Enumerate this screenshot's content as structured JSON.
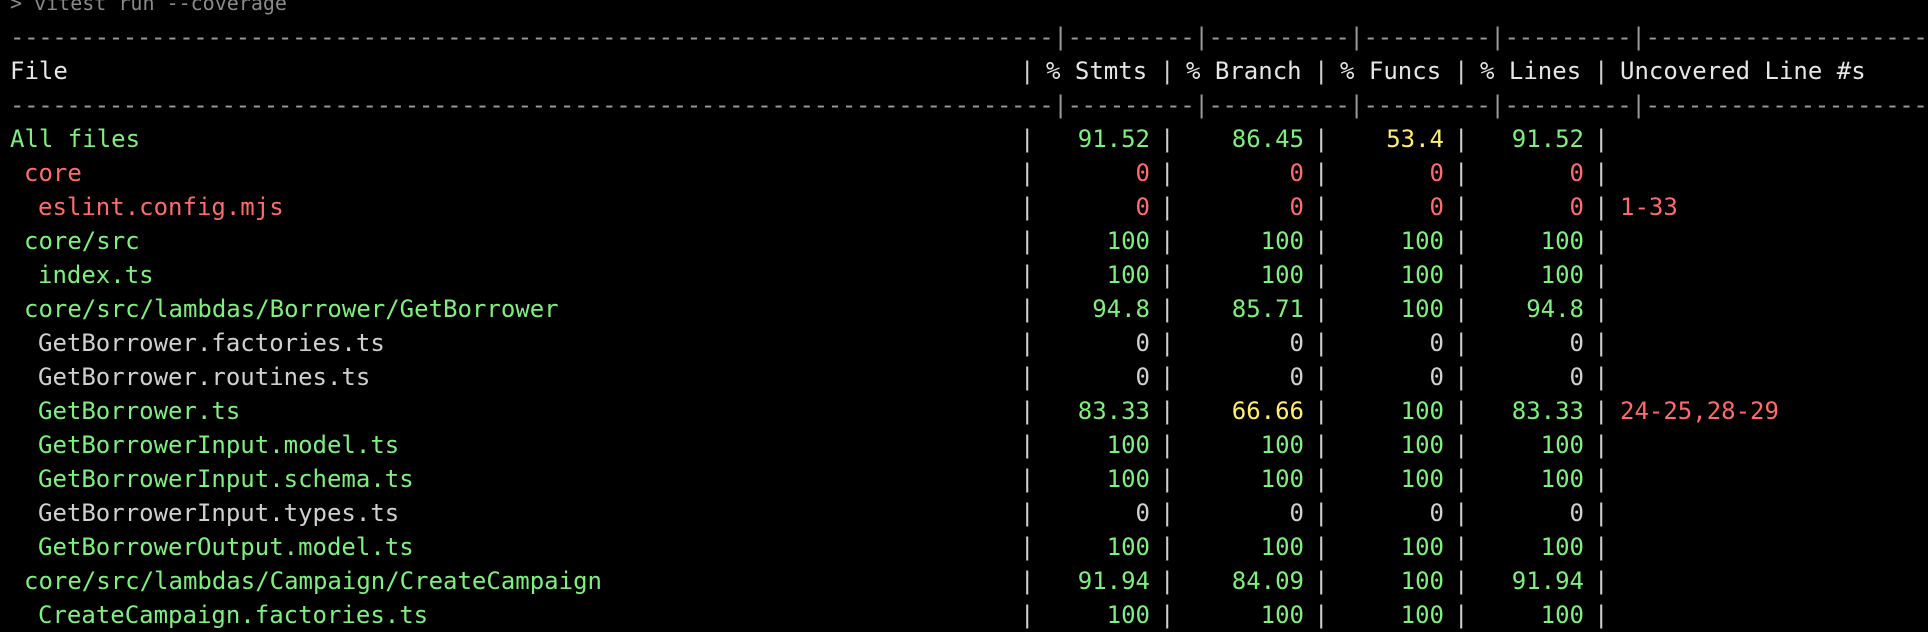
{
  "colors": {
    "green": "#7ef07e",
    "red": "#ff6b6b",
    "yellow": "#ffef6b",
    "plain": "#d0d0d0",
    "background": "#000000"
  },
  "command_line": "> vitest run --coverage",
  "separator": "--------------------------------------------------------------------------|---------|----------|---------|---------|----------------------",
  "headers": {
    "file": "File",
    "stmts": "% Stmts",
    "branch": "% Branch",
    "funcs": "% Funcs",
    "lines": "% Lines",
    "uncovered": "Uncovered Line #s"
  },
  "rows": [
    {
      "file": "All files",
      "indent": 0,
      "color": "green",
      "stmts": "91.52",
      "stmts_color": "green",
      "branch": "86.45",
      "branch_color": "green",
      "funcs": "53.4",
      "funcs_color": "yellow",
      "lines": "91.52",
      "lines_color": "green",
      "uncovered": ""
    },
    {
      "file": "core",
      "indent": 1,
      "color": "red",
      "stmts": "0",
      "stmts_color": "red",
      "branch": "0",
      "branch_color": "red",
      "funcs": "0",
      "funcs_color": "red",
      "lines": "0",
      "lines_color": "red",
      "uncovered": ""
    },
    {
      "file": "eslint.config.mjs",
      "indent": 2,
      "color": "red",
      "stmts": "0",
      "stmts_color": "red",
      "branch": "0",
      "branch_color": "red",
      "funcs": "0",
      "funcs_color": "red",
      "lines": "0",
      "lines_color": "red",
      "uncovered": "1-33"
    },
    {
      "file": "core/src",
      "indent": 1,
      "color": "green",
      "stmts": "100",
      "stmts_color": "green",
      "branch": "100",
      "branch_color": "green",
      "funcs": "100",
      "funcs_color": "green",
      "lines": "100",
      "lines_color": "green",
      "uncovered": ""
    },
    {
      "file": "index.ts",
      "indent": 2,
      "color": "green",
      "stmts": "100",
      "stmts_color": "green",
      "branch": "100",
      "branch_color": "green",
      "funcs": "100",
      "funcs_color": "green",
      "lines": "100",
      "lines_color": "green",
      "uncovered": ""
    },
    {
      "file": "core/src/lambdas/Borrower/GetBorrower",
      "indent": 1,
      "color": "green",
      "stmts": "94.8",
      "stmts_color": "green",
      "branch": "85.71",
      "branch_color": "green",
      "funcs": "100",
      "funcs_color": "green",
      "lines": "94.8",
      "lines_color": "green",
      "uncovered": ""
    },
    {
      "file": "GetBorrower.factories.ts",
      "indent": 2,
      "color": "plain",
      "stmts": "0",
      "stmts_color": "plain",
      "branch": "0",
      "branch_color": "plain",
      "funcs": "0",
      "funcs_color": "plain",
      "lines": "0",
      "lines_color": "plain",
      "uncovered": ""
    },
    {
      "file": "GetBorrower.routines.ts",
      "indent": 2,
      "color": "plain",
      "stmts": "0",
      "stmts_color": "plain",
      "branch": "0",
      "branch_color": "plain",
      "funcs": "0",
      "funcs_color": "plain",
      "lines": "0",
      "lines_color": "plain",
      "uncovered": ""
    },
    {
      "file": "GetBorrower.ts",
      "indent": 2,
      "color": "green",
      "stmts": "83.33",
      "stmts_color": "green",
      "branch": "66.66",
      "branch_color": "yellow",
      "funcs": "100",
      "funcs_color": "green",
      "lines": "83.33",
      "lines_color": "green",
      "uncovered": "24-25,28-29"
    },
    {
      "file": "GetBorrowerInput.model.ts",
      "indent": 2,
      "color": "green",
      "stmts": "100",
      "stmts_color": "green",
      "branch": "100",
      "branch_color": "green",
      "funcs": "100",
      "funcs_color": "green",
      "lines": "100",
      "lines_color": "green",
      "uncovered": ""
    },
    {
      "file": "GetBorrowerInput.schema.ts",
      "indent": 2,
      "color": "green",
      "stmts": "100",
      "stmts_color": "green",
      "branch": "100",
      "branch_color": "green",
      "funcs": "100",
      "funcs_color": "green",
      "lines": "100",
      "lines_color": "green",
      "uncovered": ""
    },
    {
      "file": "GetBorrowerInput.types.ts",
      "indent": 2,
      "color": "plain",
      "stmts": "0",
      "stmts_color": "plain",
      "branch": "0",
      "branch_color": "plain",
      "funcs": "0",
      "funcs_color": "plain",
      "lines": "0",
      "lines_color": "plain",
      "uncovered": ""
    },
    {
      "file": "GetBorrowerOutput.model.ts",
      "indent": 2,
      "color": "green",
      "stmts": "100",
      "stmts_color": "green",
      "branch": "100",
      "branch_color": "green",
      "funcs": "100",
      "funcs_color": "green",
      "lines": "100",
      "lines_color": "green",
      "uncovered": ""
    },
    {
      "file": "core/src/lambdas/Campaign/CreateCampaign",
      "indent": 1,
      "color": "green",
      "stmts": "91.94",
      "stmts_color": "green",
      "branch": "84.09",
      "branch_color": "green",
      "funcs": "100",
      "funcs_color": "green",
      "lines": "91.94",
      "lines_color": "green",
      "uncovered": ""
    },
    {
      "file": "CreateCampaign.factories.ts",
      "indent": 2,
      "color": "green",
      "stmts": "100",
      "stmts_color": "green",
      "branch": "100",
      "branch_color": "green",
      "funcs": "100",
      "funcs_color": "green",
      "lines": "100",
      "lines_color": "green",
      "uncovered": ""
    }
  ]
}
